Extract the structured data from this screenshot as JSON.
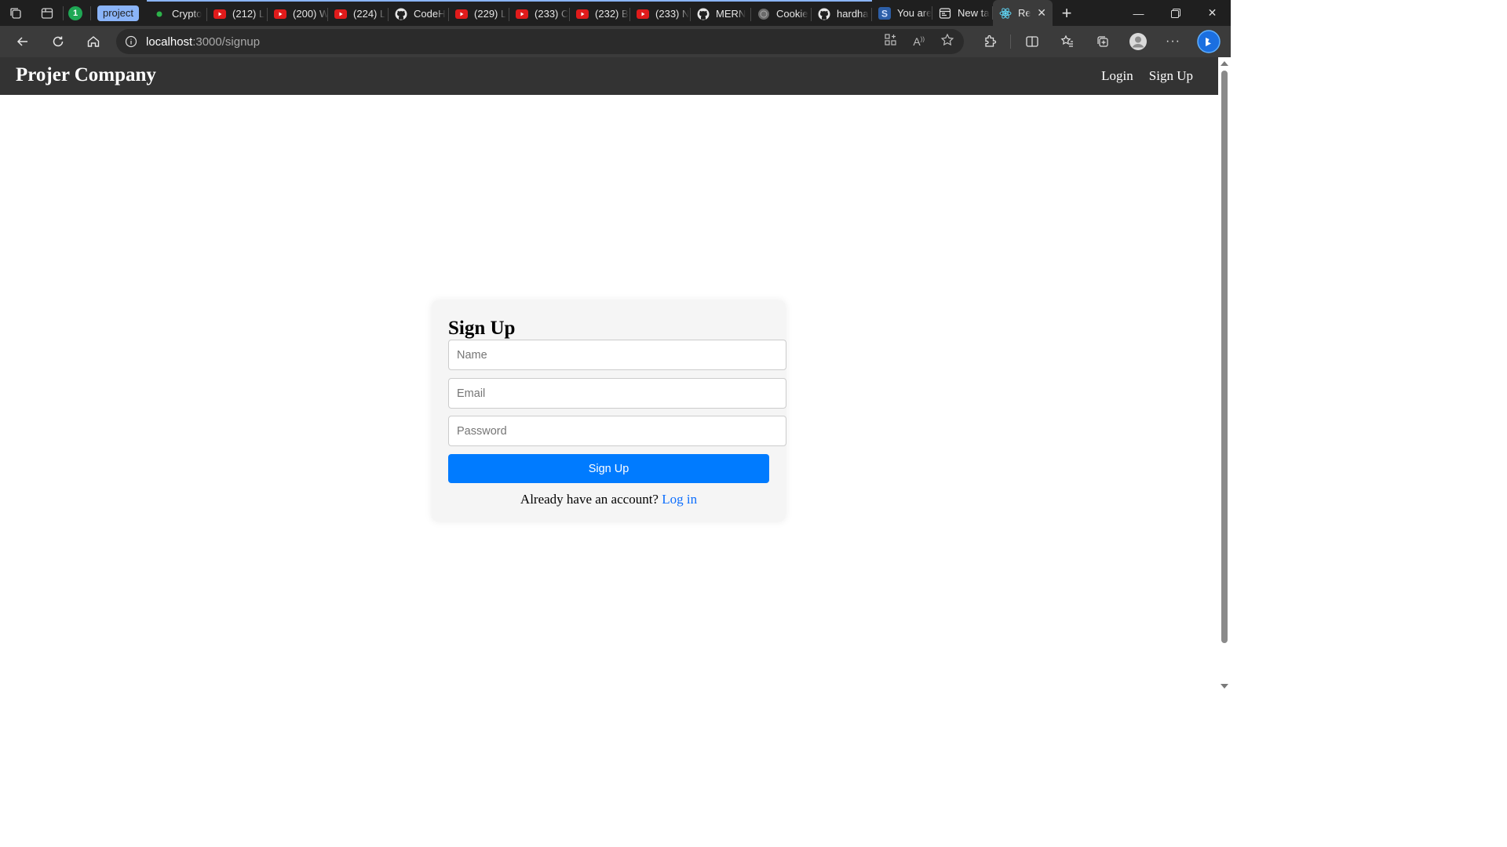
{
  "browser": {
    "group_label": "project",
    "tabs": [
      {
        "title": "Crypto",
        "icon": "green-dot-icon",
        "grouped": true
      },
      {
        "title": "(212) L",
        "icon": "youtube-icon",
        "grouped": true
      },
      {
        "title": "(200) W",
        "icon": "youtube-icon",
        "grouped": true
      },
      {
        "title": "(224) L",
        "icon": "youtube-icon",
        "grouped": true
      },
      {
        "title": "CodeH",
        "icon": "github-icon",
        "grouped": true
      },
      {
        "title": "(229) L",
        "icon": "youtube-icon",
        "grouped": true
      },
      {
        "title": "(233) C",
        "icon": "youtube-icon",
        "grouped": true
      },
      {
        "title": "(232) B",
        "icon": "youtube-icon",
        "grouped": true
      },
      {
        "title": "(233) N",
        "icon": "youtube-icon",
        "grouped": true
      },
      {
        "title": "MERN",
        "icon": "github-icon",
        "grouped": true
      },
      {
        "title": "Cookie",
        "icon": "globe-icon",
        "grouped": true
      },
      {
        "title": "hardha",
        "icon": "github-icon",
        "grouped": true
      },
      {
        "title": "You are",
        "icon": "s-icon",
        "grouped": false
      },
      {
        "title": "New ta",
        "icon": "newtab-icon",
        "grouped": false
      },
      {
        "title": "Re",
        "icon": "react-icon",
        "grouped": false,
        "active": true
      }
    ],
    "url_host": "localhost",
    "url_path": ":3000/signup"
  },
  "site": {
    "brand": "Projer Company",
    "nav": {
      "login": "Login",
      "signup": "Sign Up"
    }
  },
  "signup": {
    "title": "Sign Up",
    "name_placeholder": "Name",
    "email_placeholder": "Email",
    "password_placeholder": "Password",
    "submit_label": "Sign Up",
    "prompt": "Already have an account?",
    "login_link": "Log in"
  },
  "colors": {
    "nav_bg": "#333333",
    "button": "#007bff",
    "link": "#0d6efd",
    "card_bg": "#f5f5f5"
  }
}
